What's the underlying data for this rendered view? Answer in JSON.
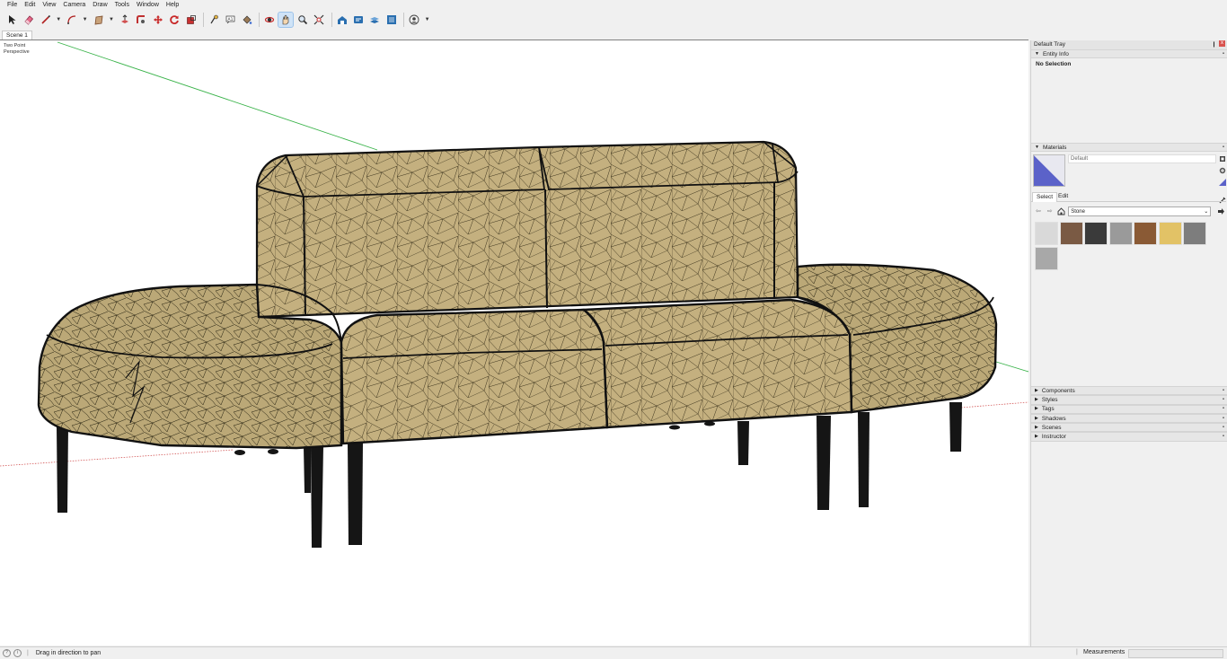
{
  "menu": [
    "File",
    "Edit",
    "View",
    "Camera",
    "Draw",
    "Tools",
    "Window",
    "Help"
  ],
  "toolbar": {
    "tools": [
      "select-icon",
      "eraser-icon",
      "line-icon",
      "arc-icon",
      "rectangle-icon",
      "push-pull-icon",
      "follow-me-icon",
      "move-icon",
      "rotate-icon",
      "scale-icon",
      "tape-measure-icon",
      "text-icon",
      "paint-bucket-icon",
      "orbit-icon",
      "pan-icon",
      "zoom-icon",
      "zoom-extents-icon",
      "warehouse-icon",
      "extension-warehouse-icon",
      "layout-icon",
      "extension-manager-icon",
      "account-icon"
    ],
    "active_tool": "pan-icon"
  },
  "scenes": {
    "tabs": [
      "Scene 1"
    ]
  },
  "viewport": {
    "camera_line1": "Two Point",
    "camera_line2": "Perspective"
  },
  "tray": {
    "title": "Default Tray",
    "pin": "❙",
    "close": "x",
    "entity_info": {
      "title": "Entity Info",
      "status": "No Selection"
    },
    "materials": {
      "title": "Materials",
      "name": "Default",
      "tab_select": "Select",
      "tab_edit": "Edit",
      "collection": "Stone",
      "swatch_colors": [
        "#d9d9d9",
        "#7a5a44",
        "#3a3a3a",
        "#9a9a9a",
        "#8a5a35",
        "#e2c266",
        "#7d7d7d",
        "#a8a8a8"
      ]
    },
    "panels": [
      "Components",
      "Styles",
      "Tags",
      "Shadows",
      "Scenes",
      "Instructor"
    ]
  },
  "status": {
    "message": "Drag in direction to pan",
    "measurements_label": "Measurements",
    "measurements_value": ""
  },
  "colors": {
    "fabric": "#c4b07f",
    "edge": "#111111",
    "green_axis": "#3ab34a",
    "red_axis": "#d45a5a"
  }
}
